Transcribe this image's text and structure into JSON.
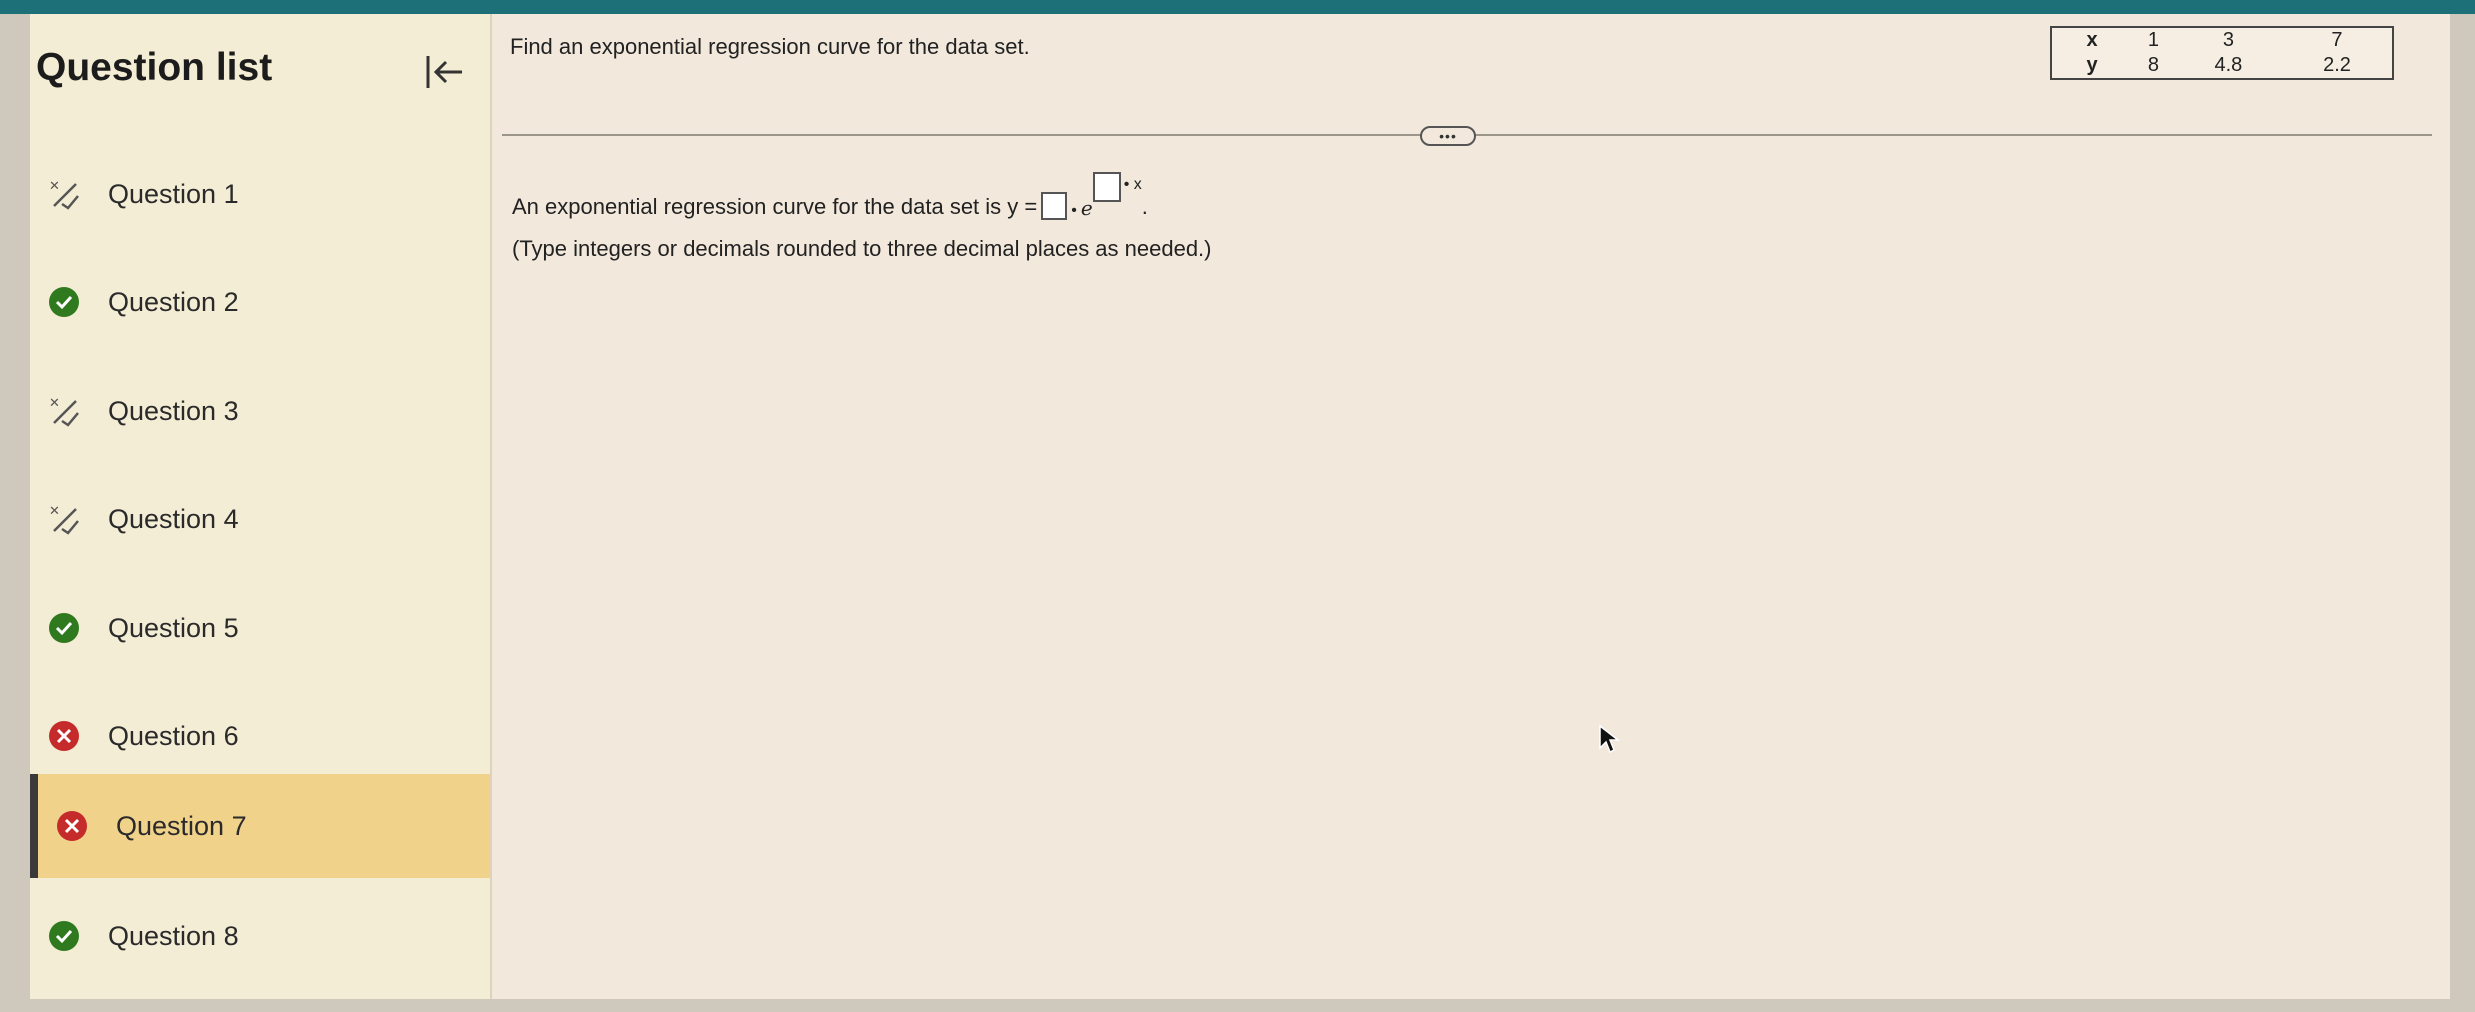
{
  "sidebar": {
    "title": "Question list",
    "items": [
      {
        "label": "Question 1",
        "status": "partial"
      },
      {
        "label": "Question 2",
        "status": "correct"
      },
      {
        "label": "Question 3",
        "status": "partial"
      },
      {
        "label": "Question 4",
        "status": "partial"
      },
      {
        "label": "Question 5",
        "status": "correct"
      },
      {
        "label": "Question 6",
        "status": "incorrect"
      },
      {
        "label": "Question 7",
        "status": "incorrect",
        "active": true
      },
      {
        "label": "Question 8",
        "status": "correct"
      }
    ]
  },
  "question": {
    "prompt": "Find an exponential regression curve for the data set.",
    "table": {
      "x_header": "x",
      "y_header": "y",
      "x_values": [
        "1",
        "3",
        "7"
      ],
      "y_values": [
        "8",
        "4.8",
        "2.2"
      ]
    },
    "answer_prefix": "An exponential regression curve for the data set is y =",
    "dot": "•",
    "e_symbol": "e",
    "exp_suffix": "• x",
    "period": ".",
    "hint": "(Type integers or decimals rounded to three decimal places as needed.)",
    "more_label": "•••"
  },
  "colors": {
    "correct": "#2f7a1f",
    "incorrect": "#c62b2b",
    "partial": "#555555",
    "active_bg": "#f0d28a",
    "topbar": "#1d6f78"
  }
}
